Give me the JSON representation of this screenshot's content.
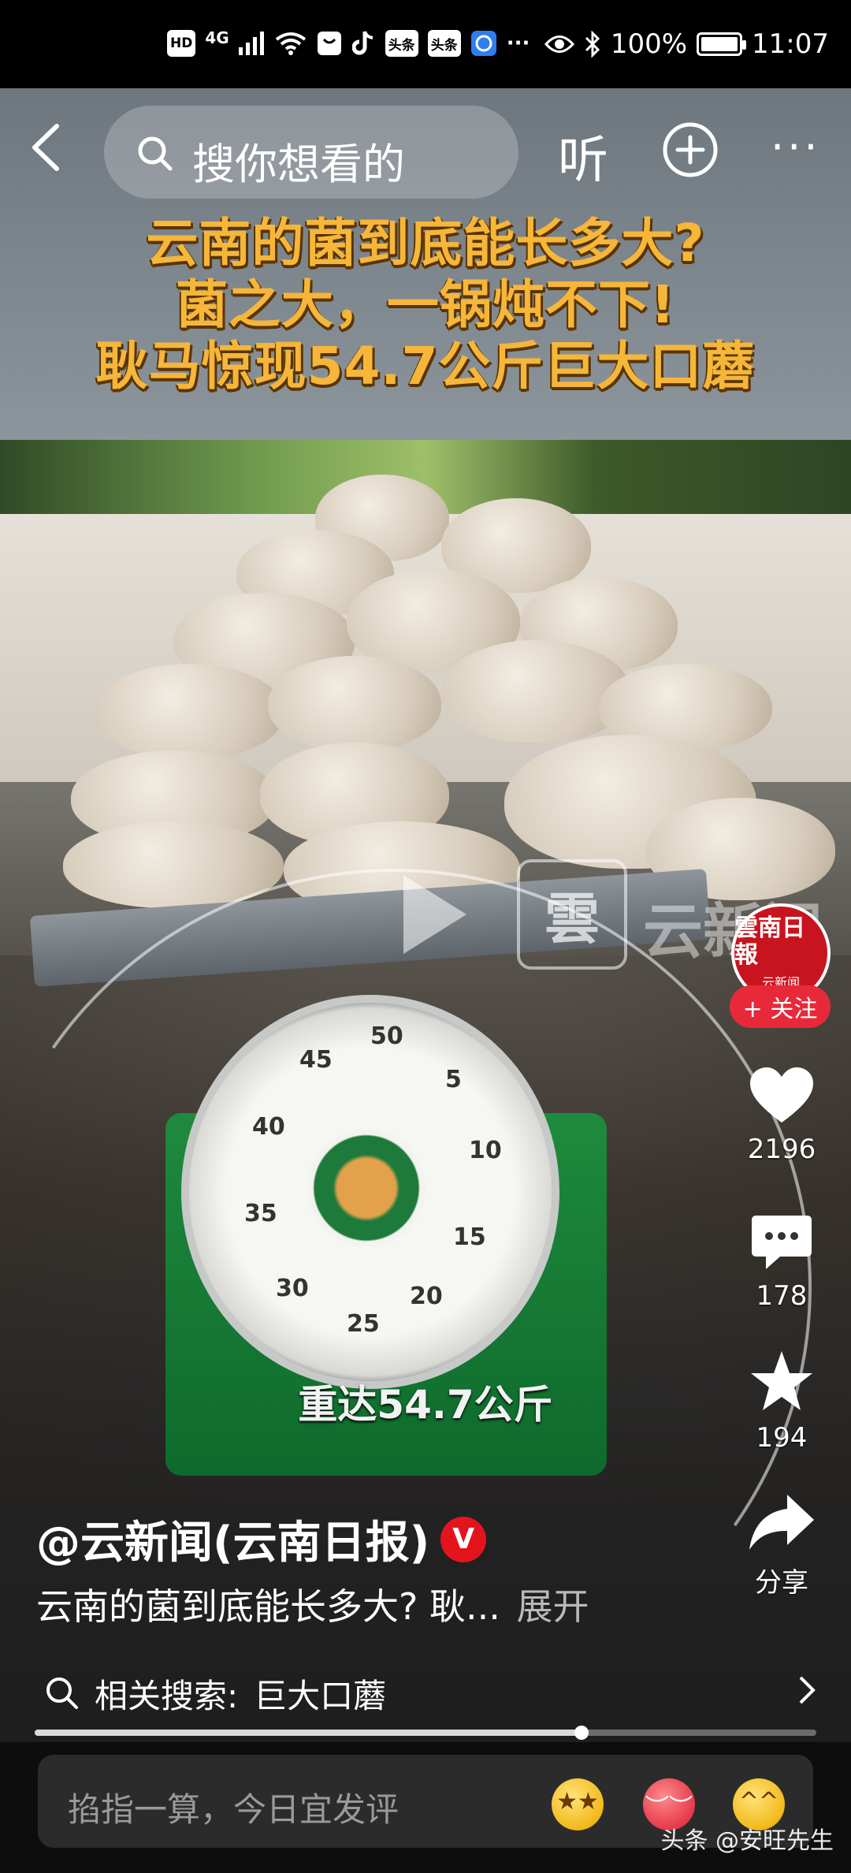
{
  "status_bar": {
    "left_chips": [
      "HD",
      "头条",
      "头条"
    ],
    "network": "4G",
    "battery": "100%",
    "time": "11:07"
  },
  "topbar": {
    "search_placeholder": "搜你想看的",
    "listen_label": "听",
    "more_label": "···"
  },
  "video": {
    "headline_lines": [
      "云南的菌到底能长多大?",
      "菌之大，一锅炖不下!",
      "耿马惊现54.7公斤巨大口蘑"
    ],
    "watermark_logo": "雲",
    "watermark_text": "云新闻",
    "caption": "重达54.7公斤",
    "dial_numbers": [
      "50",
      "45",
      "5",
      "40",
      "10",
      "35",
      "15",
      "30",
      "20",
      "25"
    ]
  },
  "right_rail": {
    "avatar_line1": "雲南日報",
    "avatar_line2": "云新闻",
    "follow_label": "+ 关注",
    "likes": "2196",
    "comments": "178",
    "favorites": "194",
    "share_label": "分享"
  },
  "post": {
    "author": "@云新闻(云南日报)",
    "verified_badge": "V",
    "description": "云南的菌到底能长多大? 耿...",
    "expand_label": "展开",
    "related_prefix": "相关搜索:",
    "related_term": "巨大口蘑",
    "progress": 0.7
  },
  "bottombar": {
    "comment_placeholder": "掐指一算，今日宜发评",
    "watermark": "头条 @安旺先生"
  }
}
